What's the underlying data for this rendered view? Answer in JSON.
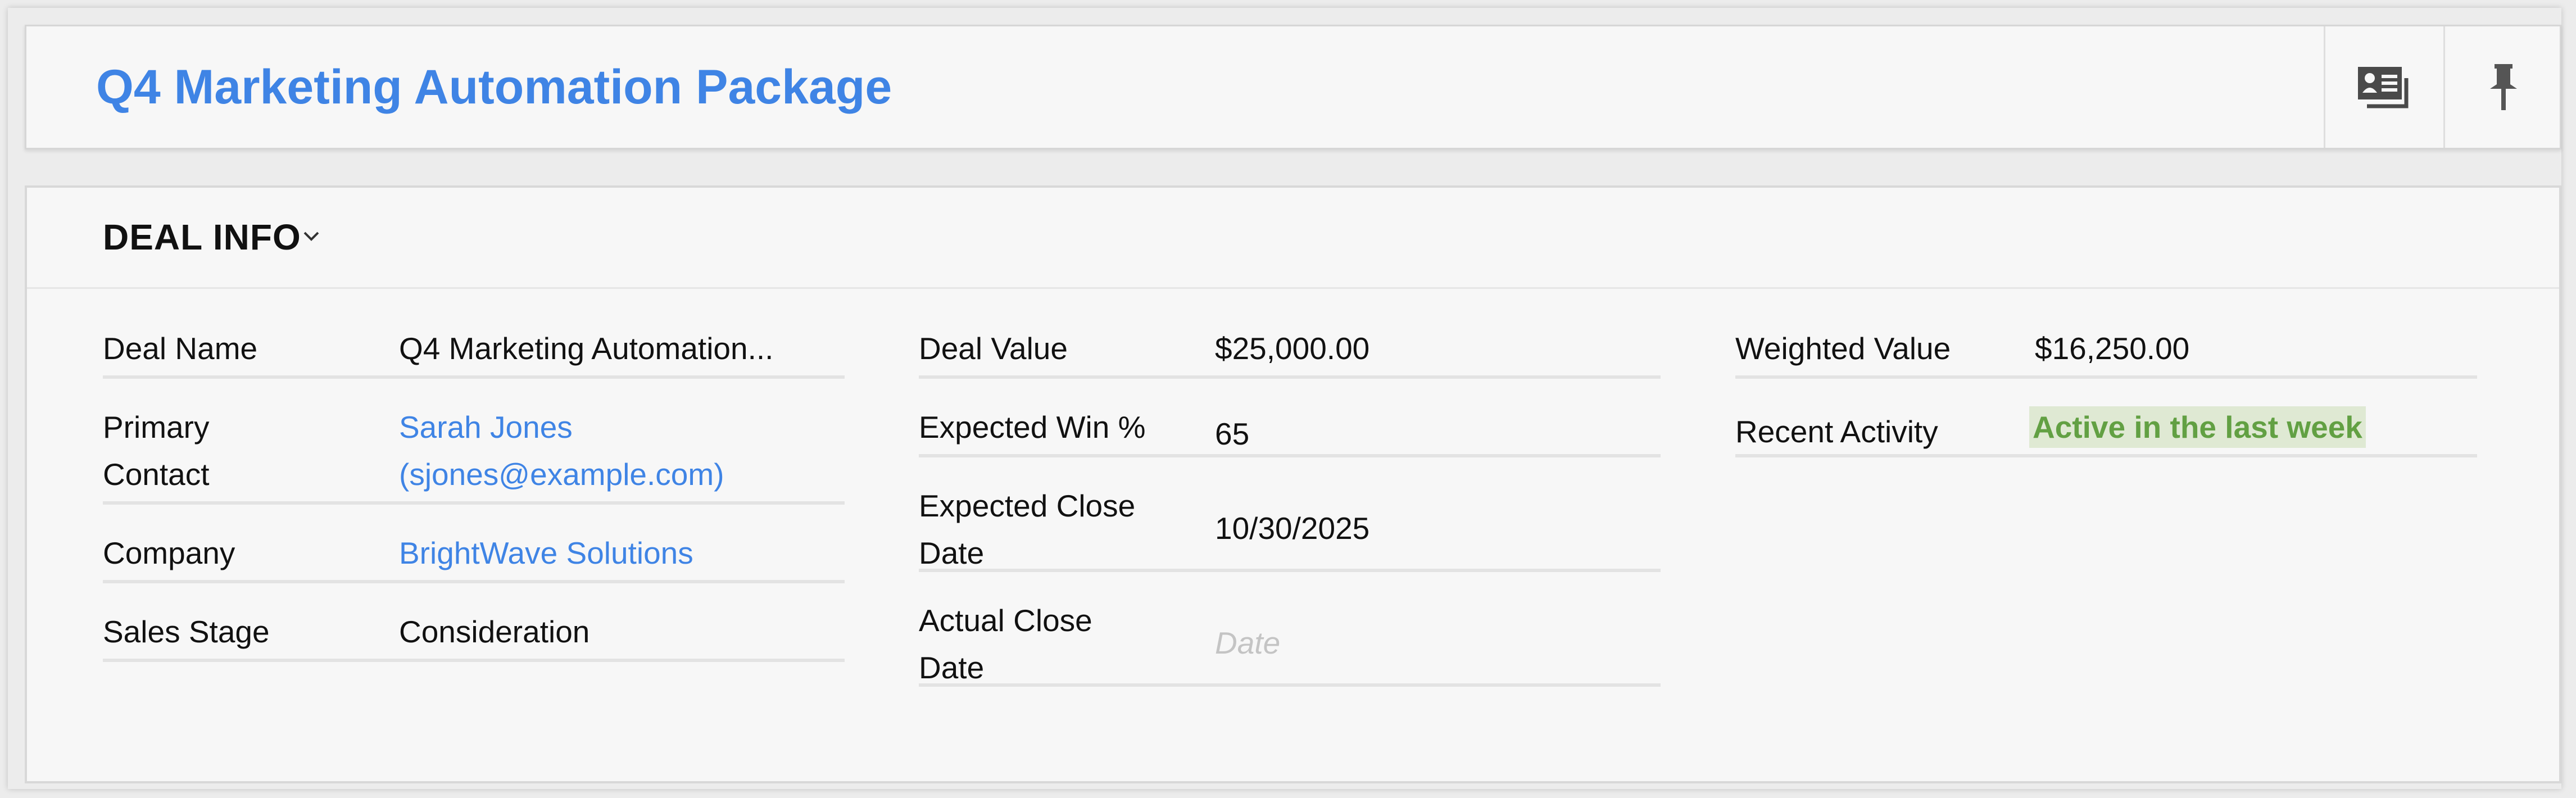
{
  "header": {
    "title": "Q4 Marketing Automation Package",
    "card_icon": "contact-card-icon",
    "pin_icon": "pin-icon"
  },
  "section": {
    "title": "DEAL INFO",
    "caret_icon": "chevron-down-icon"
  },
  "fields": {
    "deal_name": {
      "label": "Deal Name",
      "value": "Q4 Marketing Automation..."
    },
    "primary_contact": {
      "label_line1": "Primary",
      "label_line2": "Contact",
      "value_line1": "Sarah Jones",
      "value_line2": "(sjones@example.com)"
    },
    "company": {
      "label": "Company",
      "value": "BrightWave Solutions"
    },
    "sales_stage": {
      "label": "Sales Stage",
      "value": "Consideration"
    },
    "deal_value": {
      "label": "Deal Value",
      "value": "$25,000.00"
    },
    "expected_win": {
      "label": "Expected Win %",
      "value": "65"
    },
    "expected_close": {
      "label_line1": "Expected Close",
      "label_line2": "Date",
      "value": "10/30/2025"
    },
    "actual_close": {
      "label_line1": "Actual Close",
      "label_line2": "Date",
      "placeholder": "Date"
    },
    "weighted_value": {
      "label": "Weighted Value",
      "value": "$16,250.00"
    },
    "recent_activity": {
      "label": "Recent Activity",
      "value": "Active in the last week"
    }
  },
  "colors": {
    "accent": "#3f84e5",
    "activity_text": "#62a043",
    "activity_bg": "#dfe9d3"
  }
}
